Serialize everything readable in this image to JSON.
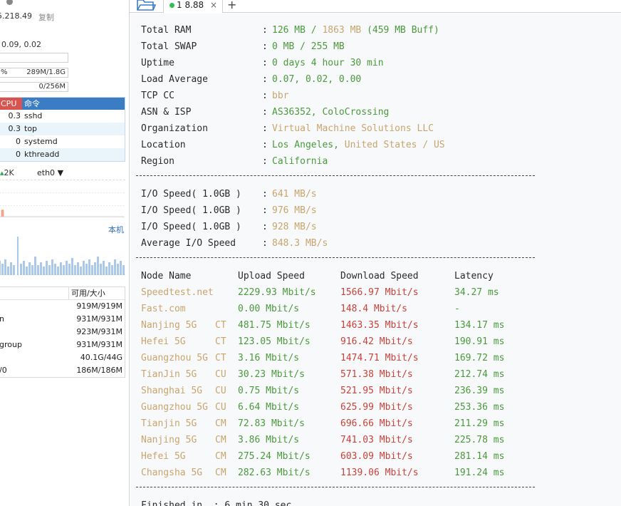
{
  "monitor": {
    "ip": "5.218.49",
    "copy_label": "复制",
    "load": "0.09, 0.02",
    "mem_bar": {
      "pct": "%",
      "value": "289M/1.8G"
    },
    "swap_bar": {
      "value": "0/256M"
    },
    "process_table": {
      "cpu_header": "CPU",
      "cmd_header": "命令",
      "rows": [
        {
          "cpu": "0.3",
          "cmd": "sshd"
        },
        {
          "cpu": "0.3",
          "cmd": "top"
        },
        {
          "cpu": "0",
          "cmd": "systemd"
        },
        {
          "cpu": "0",
          "cmd": "kthreadd"
        }
      ]
    },
    "net_up": "2K",
    "net_iface": "eth0",
    "local_label": "本机",
    "disk_table": {
      "header": "可用/大小",
      "rows": [
        {
          "name": "",
          "value": "919M/919M"
        },
        {
          "name": "n",
          "value": "931M/931M"
        },
        {
          "name": "",
          "value": "923M/931M"
        },
        {
          "name": "group",
          "value": "931M/931M"
        },
        {
          "name": "",
          "value": "40.1G/44G"
        },
        {
          "name": "/0",
          "value": "186M/186M"
        }
      ]
    }
  },
  "tabs": {
    "active_label": "1 8.88",
    "close_glyph": "×",
    "add_glyph": "+"
  },
  "terminal": {
    "sysinfo": [
      {
        "label": "Total RAM",
        "value_html": "126 MB / |1863 MB| (459 MB Buff)"
      },
      {
        "label": "Total SWAP",
        "value": "0 MB / 255 MB"
      },
      {
        "label": "Uptime",
        "value": "0 days 4 hour 30 min"
      },
      {
        "label": "Load Average",
        "value": "0.07, 0.02, 0.00"
      },
      {
        "label": "TCP CC",
        "value": "bbr"
      },
      {
        "label": "ASN & ISP",
        "value": "AS36352, ColoCrossing"
      },
      {
        "label": "Organization",
        "value": "Virtual Machine Solutions LLC"
      },
      {
        "label": "Location",
        "value": "Los Angeles, United States / US"
      },
      {
        "label": "Region",
        "value": "California"
      }
    ],
    "separator": "----------------------------------------------------------------------",
    "io": [
      {
        "label": "I/O Speed( 1.0GB )",
        "value": "641 MB/s"
      },
      {
        "label": "I/O Speed( 1.0GB )",
        "value": "976 MB/s"
      },
      {
        "label": "I/O Speed( 1.0GB )",
        "value": "928 MB/s"
      },
      {
        "label": "Average I/O Speed",
        "value": "848.3 MB/s"
      }
    ],
    "speed_header": {
      "node": "Node Name",
      "upload": "Upload Speed",
      "download": "Download Speed",
      "latency": "Latency"
    },
    "speed_rows": [
      {
        "node": "Speedtest.net",
        "isp": "",
        "upload": "2229.93 Mbit/s",
        "download": "1566.97 Mbit/s",
        "latency": "34.27 ms"
      },
      {
        "node": "Fast.com",
        "isp": "",
        "upload": "0.00 Mbit/s",
        "download": "148.4 Mbit/s",
        "latency": "-"
      },
      {
        "node": "Nanjing 5G",
        "isp": "CT",
        "upload": "481.75 Mbit/s",
        "download": "1463.35 Mbit/s",
        "latency": "134.17 ms"
      },
      {
        "node": "Hefei 5G",
        "isp": "CT",
        "upload": "123.05 Mbit/s",
        "download": "916.42 Mbit/s",
        "latency": "190.91 ms"
      },
      {
        "node": "Guangzhou 5G",
        "isp": "CT",
        "upload": "3.16 Mbit/s",
        "download": "1474.71 Mbit/s",
        "latency": "169.72 ms"
      },
      {
        "node": "TianJin 5G",
        "isp": "CU",
        "upload": "30.23 Mbit/s",
        "download": "571.38 Mbit/s",
        "latency": "212.74 ms"
      },
      {
        "node": "Shanghai 5G",
        "isp": "CU",
        "upload": "0.75 Mbit/s",
        "download": "521.95 Mbit/s",
        "latency": "236.39 ms"
      },
      {
        "node": "Guangzhou 5G",
        "isp": "CU",
        "upload": "6.64 Mbit/s",
        "download": "625.99 Mbit/s",
        "latency": "253.36 ms"
      },
      {
        "node": "Tianjin 5G",
        "isp": "CM",
        "upload": "72.83 Mbit/s",
        "download": "696.66 Mbit/s",
        "latency": "211.29 ms"
      },
      {
        "node": "Nanjing 5G",
        "isp": "CM",
        "upload": "3.86 Mbit/s",
        "download": "741.03 Mbit/s",
        "latency": "225.78 ms"
      },
      {
        "node": "Hefei 5G",
        "isp": "CM",
        "upload": "275.24 Mbit/s",
        "download": "603.09 Mbit/s",
        "latency": "281.14 ms"
      },
      {
        "node": "Changsha 5G",
        "isp": "CM",
        "upload": "282.63 Mbit/s",
        "download": "1139.06 Mbit/s",
        "latency": "191.24 ms"
      }
    ],
    "finished": "Finished in  : 6 min 30 sec"
  }
}
